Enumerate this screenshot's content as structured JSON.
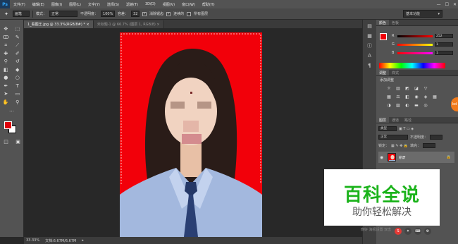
{
  "app": {
    "logo": "Ps"
  },
  "menu": [
    "文件(F)",
    "编辑(E)",
    "图像(I)",
    "图层(L)",
    "文字(Y)",
    "选择(S)",
    "滤镜(T)",
    "3D(D)",
    "视图(V)",
    "窗口(W)",
    "帮助(H)"
  ],
  "window_controls": [
    "—",
    "☐",
    "✕"
  ],
  "options": {
    "preset": "画笔",
    "mode_label": "模式：",
    "mode_value": "正常",
    "opacity_label": "不透明度：",
    "opacity_value": "100%",
    "tolerance_label": "容差：",
    "tolerance_value": "32",
    "antialias_label": "消除锯齿",
    "contiguous_label": "连续的",
    "all_layers_label": "所有图层",
    "workspace": "基本功能"
  },
  "tabs": [
    {
      "label": "1_看图王.jpg @ 33.3%(RGB/8#) * ×",
      "active": true
    },
    {
      "label": "未标题-1 @ 66.7% (图层 1, RGB/8) ×",
      "active": false
    }
  ],
  "status": {
    "zoom": "33.33%",
    "doc": "文档:6.67M/6.67M"
  },
  "color_panel": {
    "tabs": [
      "颜色",
      "色板"
    ],
    "channels": [
      {
        "name": "R",
        "value": "252"
      },
      {
        "name": "G",
        "value": "1"
      },
      {
        "name": "B",
        "value": "1"
      }
    ],
    "fg_color": "#f20108"
  },
  "adjustments_panel": {
    "tabs": [
      "调整",
      "样式"
    ],
    "title": "添加调整"
  },
  "layers_panel": {
    "tabs": [
      "图层",
      "通道",
      "路径"
    ],
    "kind": "类型",
    "blend_mode": "正常",
    "opacity_label": "不透明度：",
    "lock_label": "锁定：",
    "fill_label": "填充：",
    "layer_name": "背景"
  },
  "watermark": {
    "title": "百科全说",
    "subtitle": "助你轻松解决"
  },
  "overlay_text": "晚好 海报设置 双击",
  "colors": {
    "photo_bg": "#f2000a",
    "fg_swatch": "#e0000b",
    "bg_swatch": "#ffffff",
    "brand_green": "#1bb31b"
  }
}
